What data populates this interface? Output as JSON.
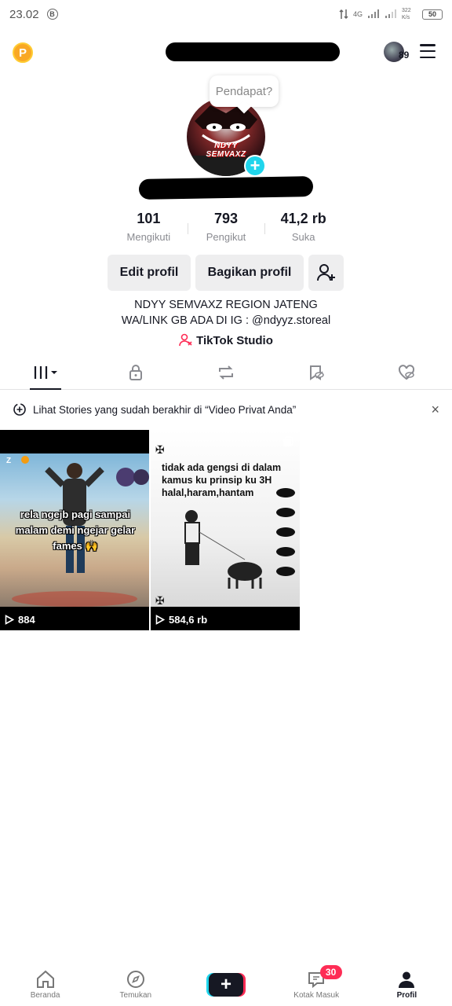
{
  "status_bar": {
    "time": "23.02",
    "b_icon": "B",
    "net": "4G",
    "speed": "322 K/s",
    "battery": "50"
  },
  "top_bar": {
    "coin_letter": "P",
    "story_count": "89"
  },
  "profile": {
    "bubble": "Pendapat?",
    "avatar_text": "NDYY SEMVAXZ",
    "avatar_plus": "+",
    "stats": [
      {
        "value": "101",
        "label": "Mengikuti"
      },
      {
        "value": "793",
        "label": "Pengikut"
      },
      {
        "value": "41,2 rb",
        "label": "Suka"
      }
    ],
    "edit_button": "Edit profil",
    "share_button": "Bagikan profil",
    "bio_line1": "NDYY SEMVAXZ REGION JATENG",
    "bio_line2": "WA/LINK GB ADA DI IG : @ndyyz.storeal",
    "studio_link": "TikTok Studio"
  },
  "stories_banner": {
    "text": "Lihat Stories yang sudah berakhir di “Video Privat Anda”",
    "close": "×"
  },
  "videos": [
    {
      "caption": "rela ngejb pagi sampai malam demi ngejar gelar fames 🙌",
      "views": "884"
    },
    {
      "caption": "tidak ada gengsi di dalam kamus ku prinsip ku 3H halal,haram,hantam",
      "views": "584,6 rb"
    }
  ],
  "bottom_nav": {
    "home": "Beranda",
    "discover": "Temukan",
    "create": "+",
    "inbox": "Kotak Masuk",
    "inbox_badge": "30",
    "profile": "Profil"
  },
  "colors": {
    "accent_cyan": "#20d5ec",
    "accent_red": "#fe2c55",
    "coin": "#f9a825"
  }
}
